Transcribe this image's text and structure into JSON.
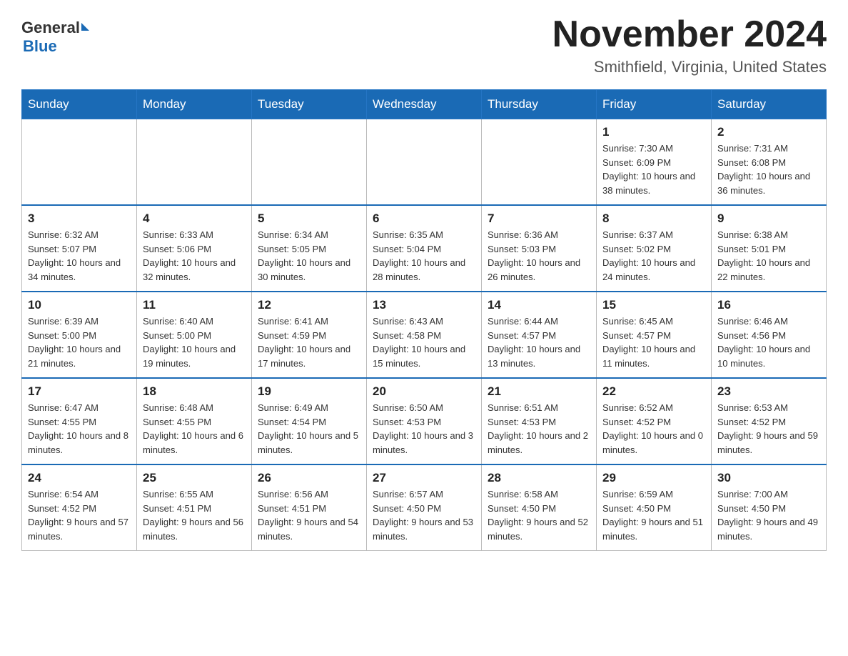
{
  "header": {
    "logo_text_general": "General",
    "logo_text_blue": "Blue",
    "month_title": "November 2024",
    "location": "Smithfield, Virginia, United States"
  },
  "weekdays": [
    "Sunday",
    "Monday",
    "Tuesday",
    "Wednesday",
    "Thursday",
    "Friday",
    "Saturday"
  ],
  "weeks": [
    [
      {
        "day": "",
        "info": ""
      },
      {
        "day": "",
        "info": ""
      },
      {
        "day": "",
        "info": ""
      },
      {
        "day": "",
        "info": ""
      },
      {
        "day": "",
        "info": ""
      },
      {
        "day": "1",
        "info": "Sunrise: 7:30 AM\nSunset: 6:09 PM\nDaylight: 10 hours and 38 minutes."
      },
      {
        "day": "2",
        "info": "Sunrise: 7:31 AM\nSunset: 6:08 PM\nDaylight: 10 hours and 36 minutes."
      }
    ],
    [
      {
        "day": "3",
        "info": "Sunrise: 6:32 AM\nSunset: 5:07 PM\nDaylight: 10 hours and 34 minutes."
      },
      {
        "day": "4",
        "info": "Sunrise: 6:33 AM\nSunset: 5:06 PM\nDaylight: 10 hours and 32 minutes."
      },
      {
        "day": "5",
        "info": "Sunrise: 6:34 AM\nSunset: 5:05 PM\nDaylight: 10 hours and 30 minutes."
      },
      {
        "day": "6",
        "info": "Sunrise: 6:35 AM\nSunset: 5:04 PM\nDaylight: 10 hours and 28 minutes."
      },
      {
        "day": "7",
        "info": "Sunrise: 6:36 AM\nSunset: 5:03 PM\nDaylight: 10 hours and 26 minutes."
      },
      {
        "day": "8",
        "info": "Sunrise: 6:37 AM\nSunset: 5:02 PM\nDaylight: 10 hours and 24 minutes."
      },
      {
        "day": "9",
        "info": "Sunrise: 6:38 AM\nSunset: 5:01 PM\nDaylight: 10 hours and 22 minutes."
      }
    ],
    [
      {
        "day": "10",
        "info": "Sunrise: 6:39 AM\nSunset: 5:00 PM\nDaylight: 10 hours and 21 minutes."
      },
      {
        "day": "11",
        "info": "Sunrise: 6:40 AM\nSunset: 5:00 PM\nDaylight: 10 hours and 19 minutes."
      },
      {
        "day": "12",
        "info": "Sunrise: 6:41 AM\nSunset: 4:59 PM\nDaylight: 10 hours and 17 minutes."
      },
      {
        "day": "13",
        "info": "Sunrise: 6:43 AM\nSunset: 4:58 PM\nDaylight: 10 hours and 15 minutes."
      },
      {
        "day": "14",
        "info": "Sunrise: 6:44 AM\nSunset: 4:57 PM\nDaylight: 10 hours and 13 minutes."
      },
      {
        "day": "15",
        "info": "Sunrise: 6:45 AM\nSunset: 4:57 PM\nDaylight: 10 hours and 11 minutes."
      },
      {
        "day": "16",
        "info": "Sunrise: 6:46 AM\nSunset: 4:56 PM\nDaylight: 10 hours and 10 minutes."
      }
    ],
    [
      {
        "day": "17",
        "info": "Sunrise: 6:47 AM\nSunset: 4:55 PM\nDaylight: 10 hours and 8 minutes."
      },
      {
        "day": "18",
        "info": "Sunrise: 6:48 AM\nSunset: 4:55 PM\nDaylight: 10 hours and 6 minutes."
      },
      {
        "day": "19",
        "info": "Sunrise: 6:49 AM\nSunset: 4:54 PM\nDaylight: 10 hours and 5 minutes."
      },
      {
        "day": "20",
        "info": "Sunrise: 6:50 AM\nSunset: 4:53 PM\nDaylight: 10 hours and 3 minutes."
      },
      {
        "day": "21",
        "info": "Sunrise: 6:51 AM\nSunset: 4:53 PM\nDaylight: 10 hours and 2 minutes."
      },
      {
        "day": "22",
        "info": "Sunrise: 6:52 AM\nSunset: 4:52 PM\nDaylight: 10 hours and 0 minutes."
      },
      {
        "day": "23",
        "info": "Sunrise: 6:53 AM\nSunset: 4:52 PM\nDaylight: 9 hours and 59 minutes."
      }
    ],
    [
      {
        "day": "24",
        "info": "Sunrise: 6:54 AM\nSunset: 4:52 PM\nDaylight: 9 hours and 57 minutes."
      },
      {
        "day": "25",
        "info": "Sunrise: 6:55 AM\nSunset: 4:51 PM\nDaylight: 9 hours and 56 minutes."
      },
      {
        "day": "26",
        "info": "Sunrise: 6:56 AM\nSunset: 4:51 PM\nDaylight: 9 hours and 54 minutes."
      },
      {
        "day": "27",
        "info": "Sunrise: 6:57 AM\nSunset: 4:50 PM\nDaylight: 9 hours and 53 minutes."
      },
      {
        "day": "28",
        "info": "Sunrise: 6:58 AM\nSunset: 4:50 PM\nDaylight: 9 hours and 52 minutes."
      },
      {
        "day": "29",
        "info": "Sunrise: 6:59 AM\nSunset: 4:50 PM\nDaylight: 9 hours and 51 minutes."
      },
      {
        "day": "30",
        "info": "Sunrise: 7:00 AM\nSunset: 4:50 PM\nDaylight: 9 hours and 49 minutes."
      }
    ]
  ]
}
